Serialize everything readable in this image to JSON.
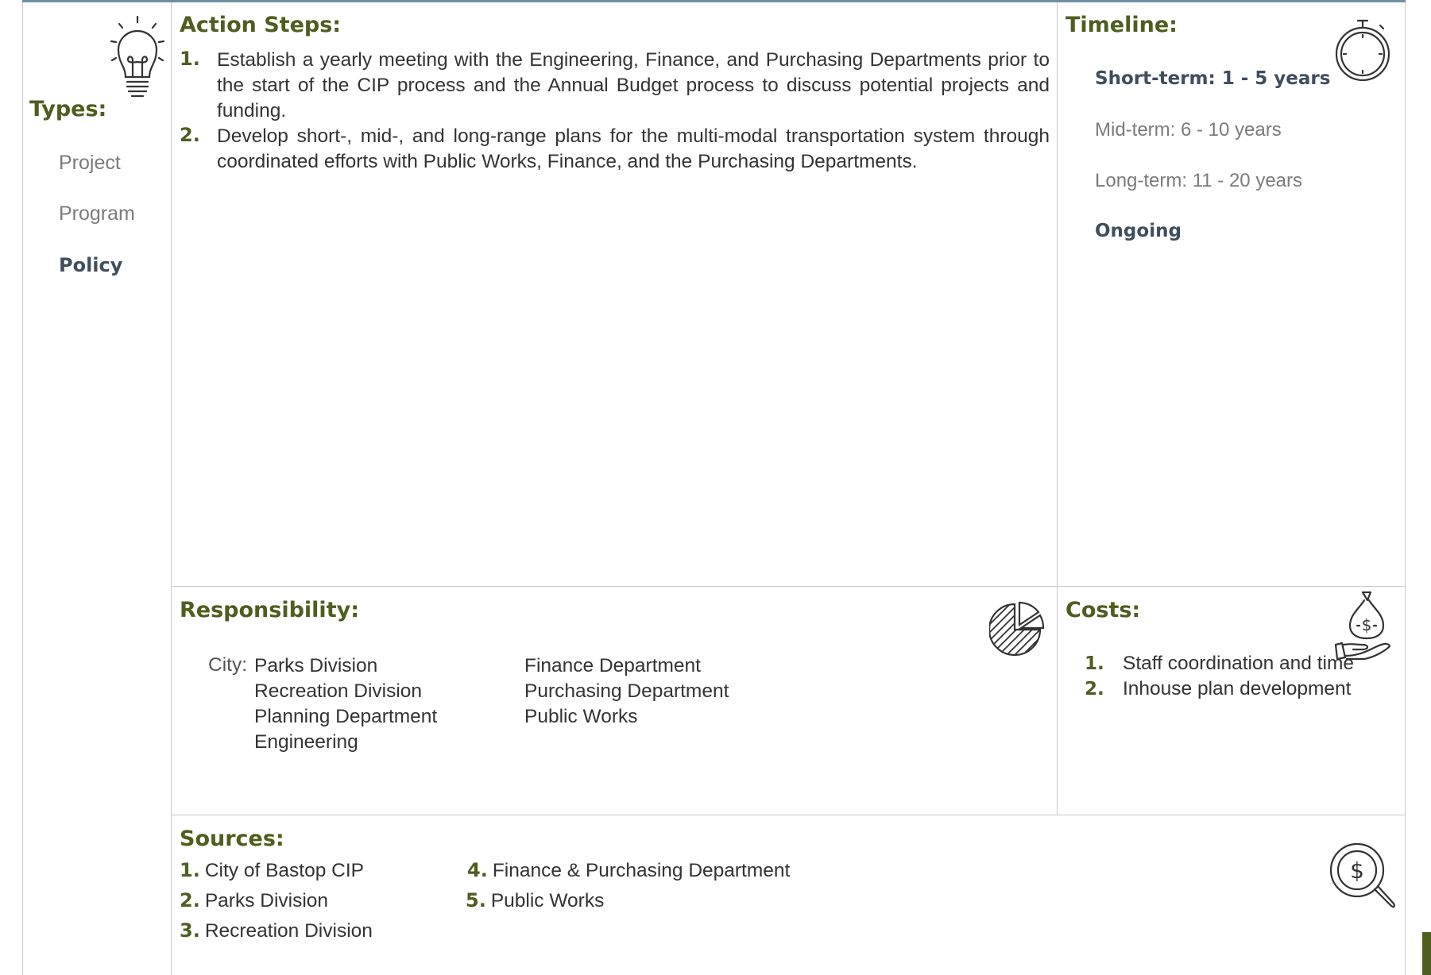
{
  "types": {
    "heading": "Types:",
    "items": [
      {
        "label": "Project"
      },
      {
        "label": "Program"
      },
      {
        "label": "Policy"
      }
    ],
    "selected": "Policy",
    "icon": "lightbulb-icon"
  },
  "action_steps": {
    "heading": "Action Steps:",
    "items": [
      {
        "num": "1.",
        "text": "Establish a yearly meeting with the Engineering, Finance, and Purchasing Departments prior to the start of the CIP process and the Annual Budget process to discuss potential projects and funding."
      },
      {
        "num": "2.",
        "text": "Develop short-, mid-, and long-range plans for the multi-modal transportation system through coordinated efforts with Public Works, Finance, and the Purchasing Departments."
      }
    ]
  },
  "timeline": {
    "heading": "Timeline:",
    "icon": "stopwatch-icon",
    "items": [
      {
        "label": "Short-term:  1 - 5 years"
      },
      {
        "label": "Mid-term:  6 - 10 years"
      },
      {
        "label": "Long-term:  11 - 20 years"
      },
      {
        "label": "Ongoing"
      }
    ],
    "selected": [
      "Short-term:  1 - 5 years",
      "Ongoing"
    ]
  },
  "responsibility": {
    "heading": "Responsibility:",
    "icon": "pie-chart-icon",
    "city_label": "City:",
    "col1": [
      "Parks Division",
      "Recreation Division",
      "Planning Department",
      "Engineering"
    ],
    "col2": [
      "Finance Department",
      "Purchasing Department",
      "Public Works"
    ]
  },
  "costs": {
    "heading": "Costs:",
    "icon": "money-bag-hand-icon",
    "items": [
      {
        "num": "1.",
        "text": "Staff coordination and time"
      },
      {
        "num": "2.",
        "text": "Inhouse plan development"
      }
    ]
  },
  "sources": {
    "heading": "Sources:",
    "icon": "dollar-magnifier-icon",
    "items": [
      {
        "num": "1.",
        "text": "City of Bastop CIP"
      },
      {
        "num": "2.",
        "text": "Parks Division"
      },
      {
        "num": "3.",
        "text": "Recreation Division"
      },
      {
        "num": "4.",
        "text": "Finance & Purchasing Department"
      },
      {
        "num": "5.",
        "text": "Public Works"
      }
    ]
  },
  "colors": {
    "heading": "#4d5e1f",
    "selected": "#3f4d5c",
    "unselected": "#7b7b7b",
    "top_rule": "#6b8fa0"
  }
}
